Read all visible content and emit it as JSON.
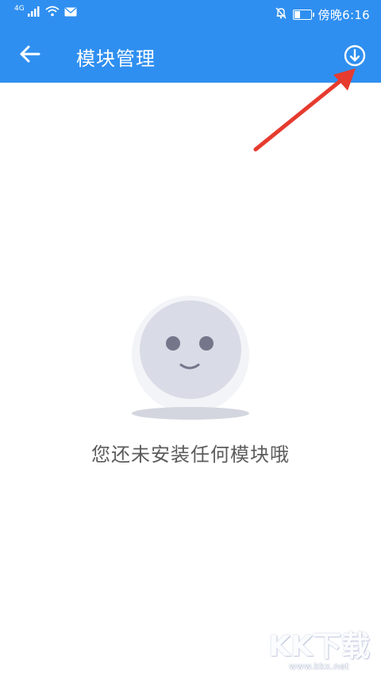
{
  "status_bar": {
    "network": "4G",
    "time": "傍晚6:16",
    "icons": [
      "signal-icon",
      "wifi-icon",
      "mail-icon",
      "notifications-off-icon",
      "battery-icon"
    ]
  },
  "toolbar": {
    "title": "模块管理",
    "background": "#2f8ff0",
    "back_icon": "arrow-left-icon",
    "download_icon": "download-circle-icon"
  },
  "annotation": {
    "color": "#e63b2e",
    "icon": "red-arrow-pointer-icon"
  },
  "empty_state": {
    "icon": "smiley-face-icon",
    "message": "您还未安装任何模块哦"
  },
  "watermark": {
    "logo": "KK下载",
    "url": "www.kkx.net"
  }
}
